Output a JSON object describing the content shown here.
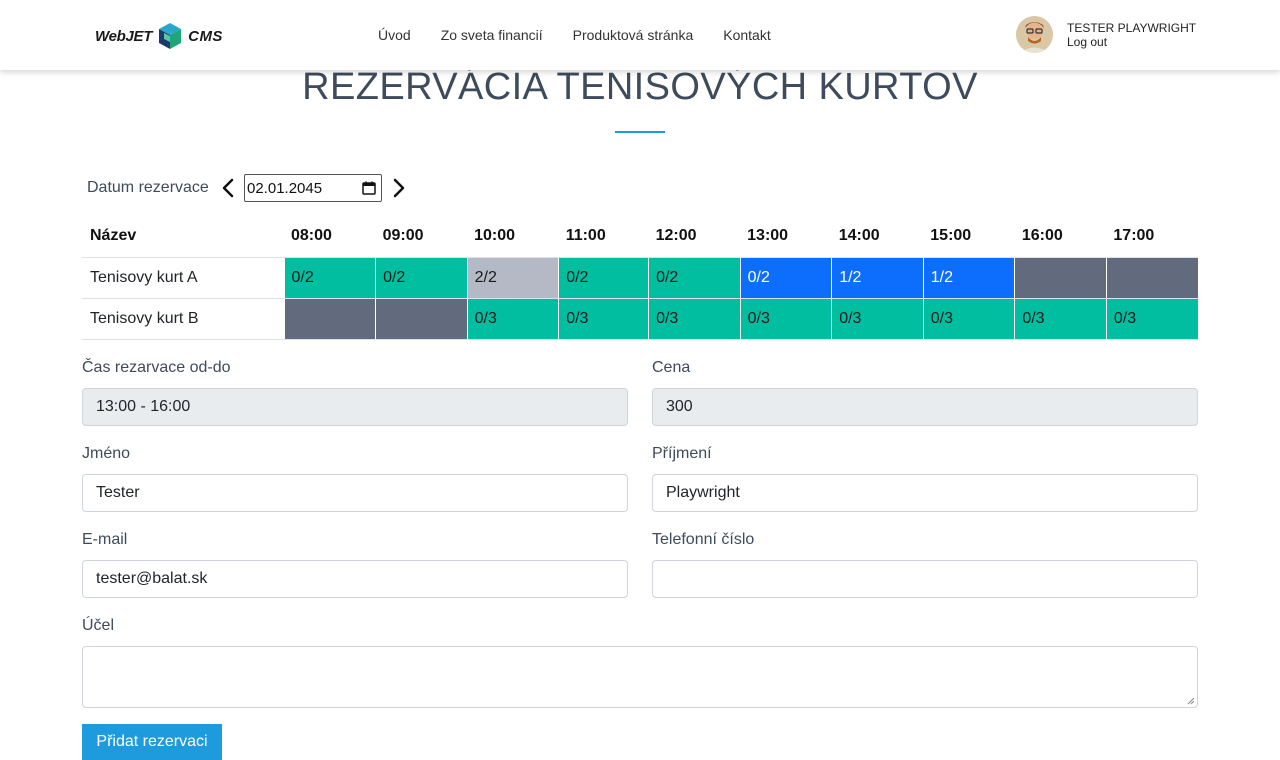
{
  "header": {
    "logo_word1": "WebJET",
    "logo_word2": "CMS",
    "nav": [
      "Úvod",
      "Zo sveta financií",
      "Produktová stránka",
      "Kontakt"
    ],
    "user_name": "TESTER PLAYWRIGHT",
    "logout_label": "Log out"
  },
  "title": "REZERVÁCIA TENISOVÝCH KURTOV",
  "date_picker": {
    "label": "Datum rezervace",
    "value": "02.01.2045"
  },
  "table": {
    "name_header": "Název",
    "hours": [
      "08:00",
      "09:00",
      "10:00",
      "11:00",
      "12:00",
      "13:00",
      "14:00",
      "15:00",
      "16:00",
      "17:00"
    ],
    "rows": [
      {
        "name": "Tenisovy kurt A",
        "slots": [
          {
            "text": "0/2",
            "state": "free"
          },
          {
            "text": "0/2",
            "state": "free"
          },
          {
            "text": "2/2",
            "state": "full"
          },
          {
            "text": "0/2",
            "state": "free"
          },
          {
            "text": "0/2",
            "state": "free"
          },
          {
            "text": "0/2",
            "state": "sel"
          },
          {
            "text": "1/2",
            "state": "sel"
          },
          {
            "text": "1/2",
            "state": "sel"
          },
          {
            "text": "",
            "state": "closed"
          },
          {
            "text": "",
            "state": "closed"
          }
        ]
      },
      {
        "name": "Tenisovy kurt B",
        "slots": [
          {
            "text": "",
            "state": "closed"
          },
          {
            "text": "",
            "state": "closed"
          },
          {
            "text": "0/3",
            "state": "free"
          },
          {
            "text": "0/3",
            "state": "free"
          },
          {
            "text": "0/3",
            "state": "free"
          },
          {
            "text": "0/3",
            "state": "free"
          },
          {
            "text": "0/3",
            "state": "free"
          },
          {
            "text": "0/3",
            "state": "free"
          },
          {
            "text": "0/3",
            "state": "free"
          },
          {
            "text": "0/3",
            "state": "free"
          }
        ]
      }
    ]
  },
  "form": {
    "time_label": "Čas rezarvace od-do",
    "time_value": "13:00 - 16:00",
    "price_label": "Cena",
    "price_value": "300",
    "first_name_label": "Jméno",
    "first_name_value": "Tester",
    "last_name_label": "Příjmení",
    "last_name_value": "Playwright",
    "email_label": "E-mail",
    "email_value": "tester@balat.sk",
    "phone_label": "Telefonní číslo",
    "phone_value": "",
    "purpose_label": "Účel",
    "purpose_value": "",
    "submit_label": "Přidat rezervaci"
  },
  "colors": {
    "free": "#00be9f",
    "full": "#b4b9c5",
    "selected": "#0d6efd",
    "closed": "#626a7e",
    "accent": "#1e9bdc"
  }
}
